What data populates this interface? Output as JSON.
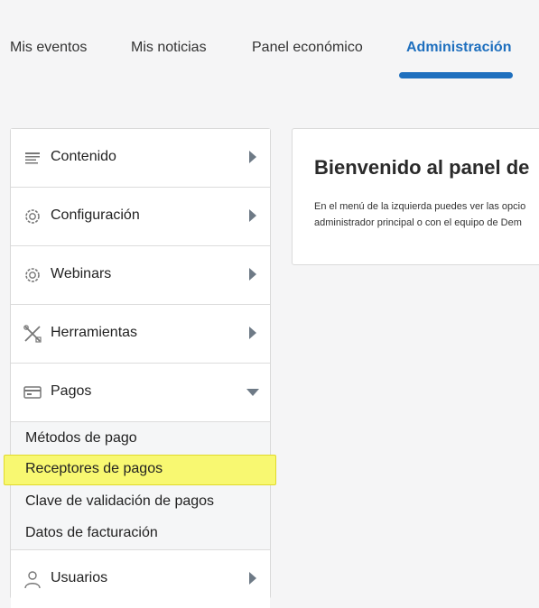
{
  "tabs": [
    {
      "label": "Mis eventos"
    },
    {
      "label": "Mis noticias"
    },
    {
      "label": "Panel económico"
    },
    {
      "label": "Administración",
      "active": true
    }
  ],
  "colors": {
    "accent": "#1e6fbe",
    "highlight": "#f8f871"
  },
  "sidebar": {
    "items": [
      {
        "label": "Contenido",
        "icon": "list-icon",
        "expanded": false
      },
      {
        "label": "Configuración",
        "icon": "gear-icon",
        "expanded": false
      },
      {
        "label": "Webinars",
        "icon": "gear-icon",
        "expanded": false
      },
      {
        "label": "Herramientas",
        "icon": "tools-icon",
        "expanded": false
      },
      {
        "label": "Pagos",
        "icon": "card-icon",
        "expanded": true
      },
      {
        "label": "Usuarios",
        "icon": "user-icon",
        "expanded": false
      }
    ],
    "submenu": [
      {
        "label": "Métodos de pago"
      },
      {
        "label": "Receptores de pagos",
        "highlighted": true
      },
      {
        "label": "Clave de validación de pagos"
      },
      {
        "label": "Datos de facturación"
      }
    ]
  },
  "panel": {
    "title": "Bienvenido al panel de",
    "line1": "En el menú de la izquierda puedes ver las opcio",
    "line2": "administrador principal o con el equipo de Dem"
  }
}
